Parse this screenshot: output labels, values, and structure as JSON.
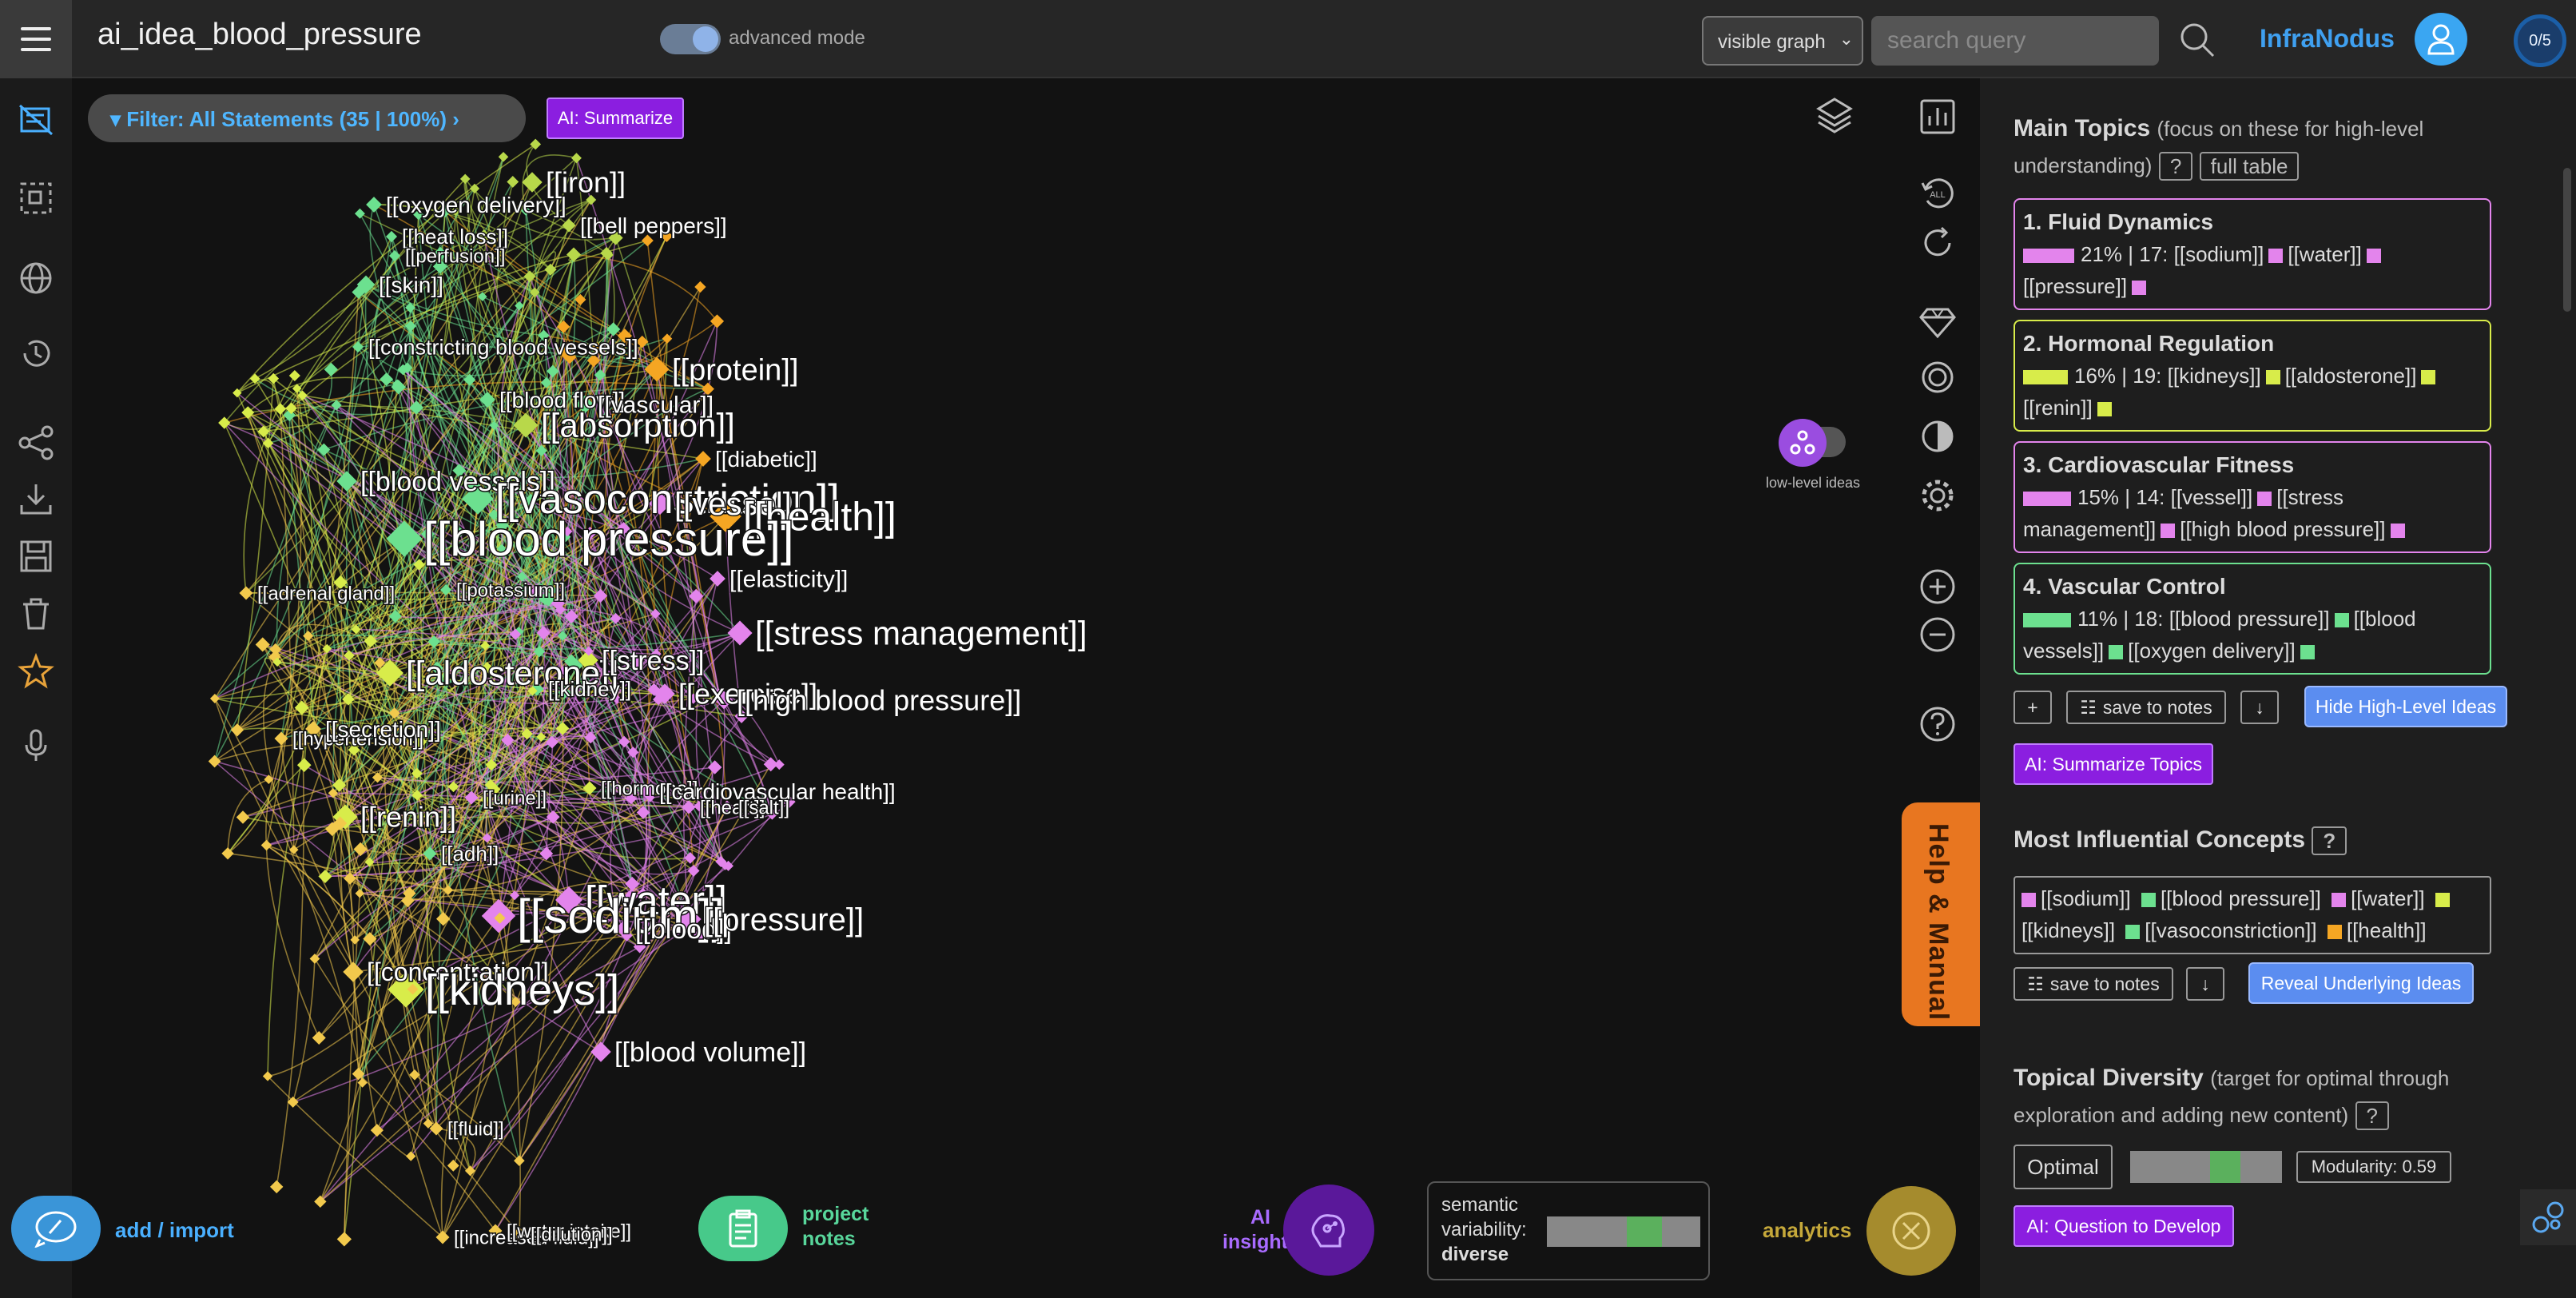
{
  "app": {
    "title": "ai_idea_blood_pressure",
    "advanced_mode_label": "advanced mode",
    "advanced_mode_on": true,
    "graph_select_value": "visible graph",
    "search_placeholder": "search query",
    "brand": "InfraNodus",
    "counter": "0/5"
  },
  "left_sidebar": {
    "icons": [
      "notes-stack-icon",
      "selection-box-icon",
      "globe-icon",
      "history-icon",
      "share-nodes-icon",
      "download-icon",
      "save-icon",
      "trash-icon",
      "star-icon",
      "microphone-icon"
    ]
  },
  "graph_toolbar": {
    "filter_label": "Filter: All Statements (35 | 100%)",
    "ai_summarize": "AI: Summarize",
    "low_level_label": "low-level ideas",
    "tools": [
      "layers-icon",
      "bar-chart-icon",
      "reset-all-icon",
      "reload-icon",
      "gem-icon",
      "circle-icon",
      "contrast-icon",
      "settings-icon",
      "zoom-in-icon",
      "zoom-out-icon",
      "help-icon"
    ],
    "reset_all_text": "ALL"
  },
  "help_tab": "Help & Manual",
  "bottom_bar": {
    "add_import": "add / import",
    "project_notes": [
      "project",
      "notes"
    ],
    "ai_insights": [
      "AI",
      "insights"
    ],
    "semantic_variability": [
      "semantic",
      "variability:",
      "diverse"
    ],
    "analytics": "analytics"
  },
  "graph": {
    "colors": {
      "pink": "#e384ec",
      "green": "#6ce08f",
      "yellow": "#d8ec4a",
      "gold": "#f2c94c",
      "orange": "#f5a623",
      "lime": "#b8d84a"
    },
    "labels": [
      {
        "t": "[[oxygen delivery]]",
        "c": "green"
      },
      {
        "t": "[[iron]]",
        "c": "lime"
      },
      {
        "t": "[[heat loss]]",
        "c": "green"
      },
      {
        "t": "[[bell peppers]]",
        "c": "lime"
      },
      {
        "t": "[[perfusion]]",
        "c": "green"
      },
      {
        "t": "[[skin]]",
        "c": "green"
      },
      {
        "t": "[[constricting blood vessels]]",
        "c": "green"
      },
      {
        "t": "[[protein]]",
        "c": "orange"
      },
      {
        "t": "[[blood flow]]",
        "c": "green"
      },
      {
        "t": "[[vascular]]",
        "c": "green"
      },
      {
        "t": "[[absorption]]",
        "c": "lime"
      },
      {
        "t": "[[diabetic]]",
        "c": "orange"
      },
      {
        "t": "[[blood vessels]]",
        "c": "green"
      },
      {
        "t": "[[vasoconstriction]]",
        "c": "green"
      },
      {
        "t": "[[vessel]]",
        "c": "pink"
      },
      {
        "t": "[[health]]",
        "c": "orange"
      },
      {
        "t": "[[blood pressure]]",
        "c": "green"
      },
      {
        "t": "[[adrenal gland]]",
        "c": "gold"
      },
      {
        "t": "[[potassium]]",
        "c": "green"
      },
      {
        "t": "[[elasticity]]",
        "c": "pink"
      },
      {
        "t": "[[stress management]]",
        "c": "pink"
      },
      {
        "t": "[[aldosterone]]",
        "c": "yellow"
      },
      {
        "t": "[[stress]]",
        "c": "yellow"
      },
      {
        "t": "[[kidney]]",
        "c": "green"
      },
      {
        "t": "[[exercise]]",
        "c": "pink"
      },
      {
        "t": "[[high blood pressure]]",
        "c": "pink"
      },
      {
        "t": "[[hypertension]]",
        "c": "gold"
      },
      {
        "t": "[[secretion]]",
        "c": "gold"
      },
      {
        "t": "[[hormone]]",
        "c": "yellow"
      },
      {
        "t": "[[cardiovascular health]]",
        "c": "pink"
      },
      {
        "t": "[[urine]]",
        "c": "pink"
      },
      {
        "t": "[[heart]]",
        "c": "pink"
      },
      {
        "t": "[[salt]]",
        "c": "pink"
      },
      {
        "t": "[[renin]]",
        "c": "yellow"
      },
      {
        "t": "[[adh]]",
        "c": "green"
      },
      {
        "t": "[[water]]",
        "c": "pink"
      },
      {
        "t": "[[sodium]]",
        "c": "pink"
      },
      {
        "t": "[[blood]]",
        "c": "pink"
      },
      {
        "t": "[[pressure]]",
        "c": "pink"
      },
      {
        "t": "[[concentration]]",
        "c": "gold"
      },
      {
        "t": "[[kidneys]]",
        "c": "yellow"
      },
      {
        "t": "[[blood volume]]",
        "c": "pink"
      },
      {
        "t": "[[fluid]]",
        "c": "gold"
      },
      {
        "t": "[[increased fluid]]",
        "c": "gold"
      },
      {
        "t": "[[water intake]]",
        "c": "gold"
      },
      {
        "t": "[[dilution]]",
        "c": "gold"
      }
    ]
  },
  "right_panel": {
    "main_topics_title": "Main Topics",
    "main_topics_sub": "(focus on these for high-level understanding)",
    "q": "?",
    "full_table": "full table",
    "topics": [
      {
        "title": "1. Fluid Dynamics",
        "color": "#e384ec",
        "stats": "21% | 17:",
        "terms": [
          "[[sodium]]",
          "[[water]]",
          "[[pressure]]"
        ]
      },
      {
        "title": "2. Hormonal Regulation",
        "color": "#d8ec4a",
        "stats": "16% | 19:",
        "terms": [
          "[[kidneys]]",
          "[[aldosterone]]",
          "[[renin]]"
        ]
      },
      {
        "title": "3. Cardiovascular Fitness",
        "color": "#e384ec",
        "stats": "15% | 14:",
        "terms": [
          "[[vessel]]",
          "[[stress management]]",
          "[[high blood pressure]]"
        ]
      },
      {
        "title": "4. Vascular Control",
        "color": "#6ce08f",
        "stats": "11% | 18:",
        "terms": [
          "[[blood pressure]]",
          "[[blood vessels]]",
          "[[oxygen delivery]]"
        ]
      }
    ],
    "plus": "+",
    "save_to_notes": "save to notes",
    "down_arrow": "↓",
    "hide_high_level": "Hide High-Level Ideas",
    "ai_summarize_topics": "AI: Summarize Topics",
    "influential_title": "Most Influential Concepts",
    "concepts": [
      {
        "t": "[[sodium]]",
        "c": "#e384ec"
      },
      {
        "t": "[[blood pressure]]",
        "c": "#6ce08f"
      },
      {
        "t": "[[water]]",
        "c": "#e384ec"
      },
      {
        "t": "[[kidneys]]",
        "c": "#d8ec4a"
      },
      {
        "t": "[[vasoconstriction]]",
        "c": "#6ce08f"
      },
      {
        "t": "[[health]]",
        "c": "#f5a623"
      }
    ],
    "reveal_underlying": "Reveal Underlying Ideas",
    "diversity_title": "Topical Diversity",
    "diversity_sub": "(target for optimal through exploration and adding new content)",
    "optimal": "Optimal",
    "modularity": "Modularity: 0.59",
    "ai_question": "AI: Question to Develop"
  }
}
